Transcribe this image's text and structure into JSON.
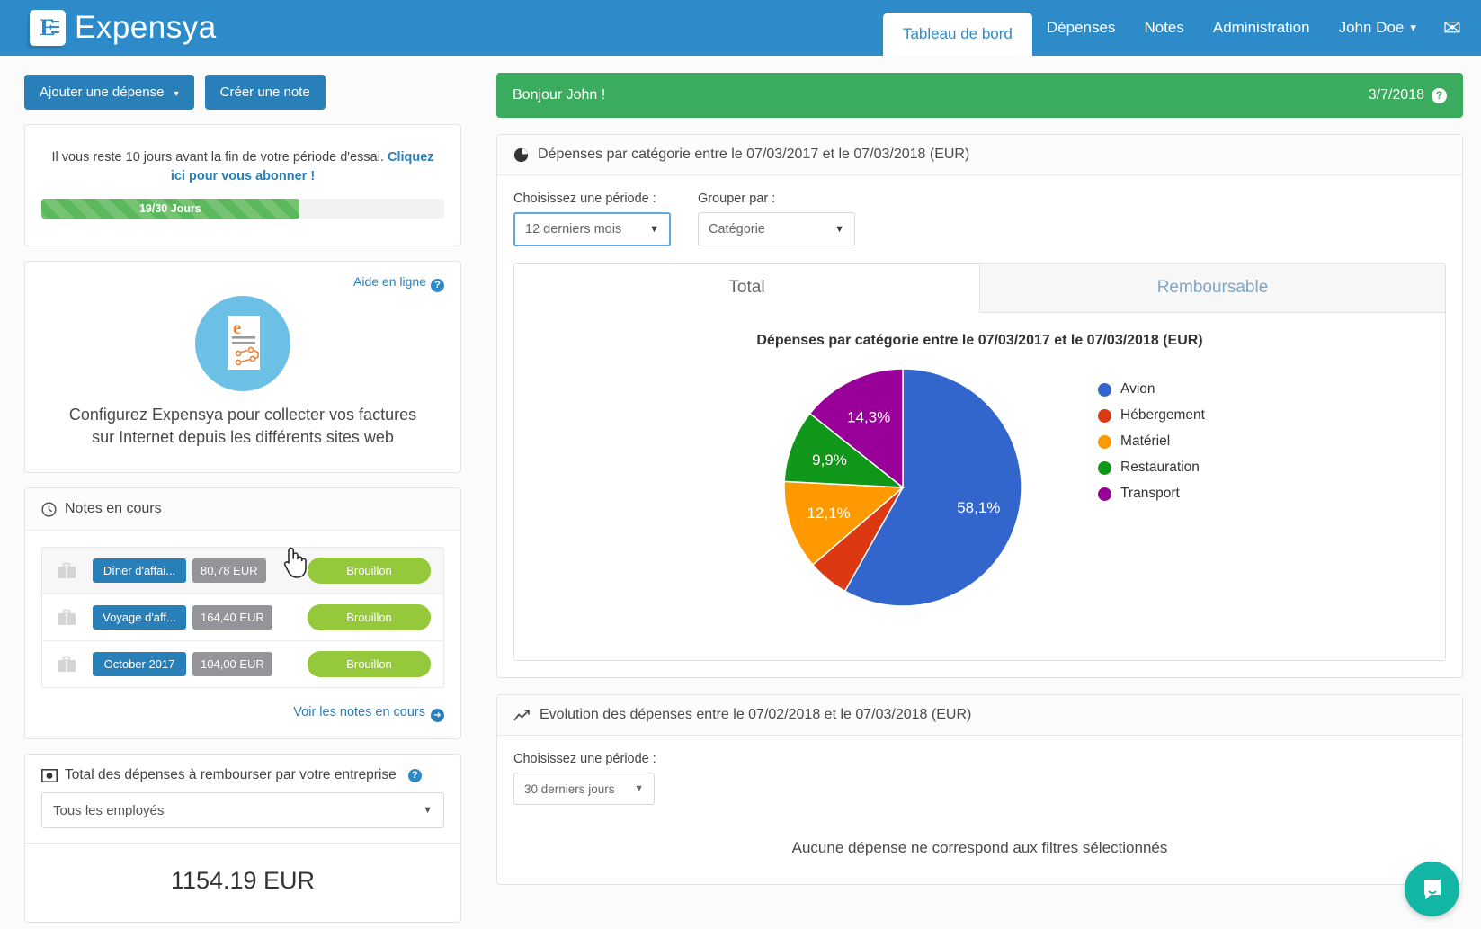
{
  "topnav": {
    "brand": "Expensya",
    "brand_letter": "E",
    "items": [
      {
        "label": "Tableau de bord",
        "active": true
      },
      {
        "label": "Dépenses",
        "active": false
      },
      {
        "label": "Notes",
        "active": false
      },
      {
        "label": "Administration",
        "active": false
      }
    ],
    "user": "John Doe",
    "caret": "▾",
    "mail_icon": "✉"
  },
  "sidebar": {
    "add_expense_button": "Ajouter une dépense",
    "create_note_button": "Créer une note",
    "trial": {
      "text_before": "Il vous reste 10 jours avant la fin de votre période d'essai. ",
      "link": "Cliquez ici pour vous abonner !",
      "progress_label": "19/30 Jours",
      "progress_percent": 64
    },
    "config": {
      "help_link": "Aide en ligne",
      "caption": "Configurez Expensya pour collecter vos factures sur Internet depuis les différents sites web"
    },
    "notes": {
      "title": "Notes en cours",
      "rows": [
        {
          "name": "Dîner d'affai...",
          "amount": "80,78 EUR",
          "status": "Brouillon"
        },
        {
          "name": "Voyage d'aff...",
          "amount": "164,40 EUR",
          "status": "Brouillon"
        },
        {
          "name": "October 2017",
          "amount": "104,00 EUR",
          "status": "Brouillon"
        }
      ],
      "see_all": "Voir les notes en cours"
    },
    "total": {
      "title": "Total des dépenses à rembourser par votre entreprise",
      "employee_filter": "Tous les employés",
      "amount": "1154.19 EUR"
    }
  },
  "content": {
    "greeting": "Bonjour John !",
    "date": "3/7/2018",
    "category_panel": {
      "header": "Dépenses par catégorie entre le 07/03/2017 et le 07/03/2018 (EUR)",
      "period_label": "Choisissez une période :",
      "period_value": "12 derniers mois",
      "group_label": "Grouper par :",
      "group_value": "Catégorie",
      "tabs": [
        {
          "label": "Total",
          "active": true
        },
        {
          "label": "Remboursable",
          "active": false
        }
      ]
    },
    "evolution_panel": {
      "header": "Evolution des dépenses entre le 07/02/2018 et le 07/03/2018 (EUR)",
      "period_label": "Choisissez une période :",
      "period_value": "30 derniers jours",
      "empty_message": "Aucune dépense ne correspond aux filtres sélectionnés"
    }
  },
  "chart_data": {
    "type": "pie",
    "title": "Dépenses par catégorie entre le 07/03/2017 et le 07/03/2018 (EUR)",
    "categories": [
      "Avion",
      "Hébergement",
      "Matériel",
      "Restauration",
      "Transport"
    ],
    "values": [
      58.1,
      5.6,
      12.1,
      9.9,
      14.3
    ],
    "labels": [
      "58,1%",
      "",
      "12,1%",
      "9,9%",
      "14,3%"
    ],
    "colors": [
      "#3366cc",
      "#dc3912",
      "#ff9900",
      "#109618",
      "#990099"
    ],
    "legend_position": "right",
    "unit": "%"
  },
  "icons": {
    "pie_icon": "◕",
    "clock_icon": "◴",
    "money_icon": "◎",
    "chart_line_icon": "↗",
    "arrow_right": "➜",
    "question": "?",
    "caret_down": "▾",
    "caret_down_small": "▼"
  }
}
